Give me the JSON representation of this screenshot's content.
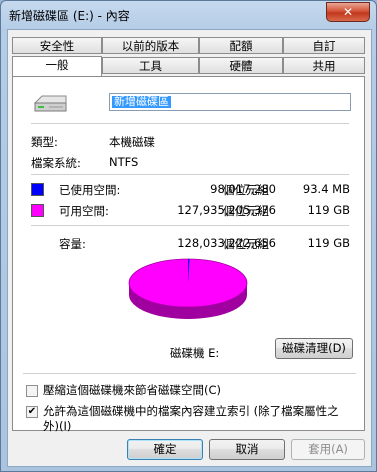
{
  "window": {
    "title": "新增磁碟區 (E:) - 內容",
    "close_label": "✕"
  },
  "tabs_row1": [
    "安全性",
    "以前的版本",
    "配額",
    "自訂"
  ],
  "tabs_row2": [
    "一般",
    "工具",
    "硬體",
    "共用"
  ],
  "active_tab": "一般",
  "drive": {
    "name": "新增磁碟區"
  },
  "info": {
    "type_label": "類型:",
    "type_value": "本機磁碟",
    "fs_label": "檔案系統:",
    "fs_value": "NTFS"
  },
  "space": {
    "used": {
      "label": "已使用空間:",
      "bytes": "98,017,280",
      "unit": "個位元組",
      "size": "93.4 MB",
      "color": "#0000ff"
    },
    "free": {
      "label": "可用空間:",
      "bytes": "127,935,205,376",
      "unit": "個位元組",
      "size": "119 GB",
      "color": "#ff00ff"
    },
    "capacity": {
      "label": "容量:",
      "bytes": "128,033,222,656",
      "unit": "個位元組",
      "size": "119 GB"
    }
  },
  "pie": {
    "used_fraction": 0.0008,
    "drive_label": "磁碟機 E:"
  },
  "cleanup_button": "磁碟清理(D)",
  "options": {
    "compress": {
      "label": "壓縮這個磁碟機來節省磁碟空間(C)",
      "checked": false
    },
    "index": {
      "label": "允許為這個磁碟機中的檔案內容建立索引 (除了檔案屬性之外)(I)",
      "checked": true
    }
  },
  "buttons": {
    "ok": "確定",
    "cancel": "取消",
    "apply": "套用(A)"
  }
}
